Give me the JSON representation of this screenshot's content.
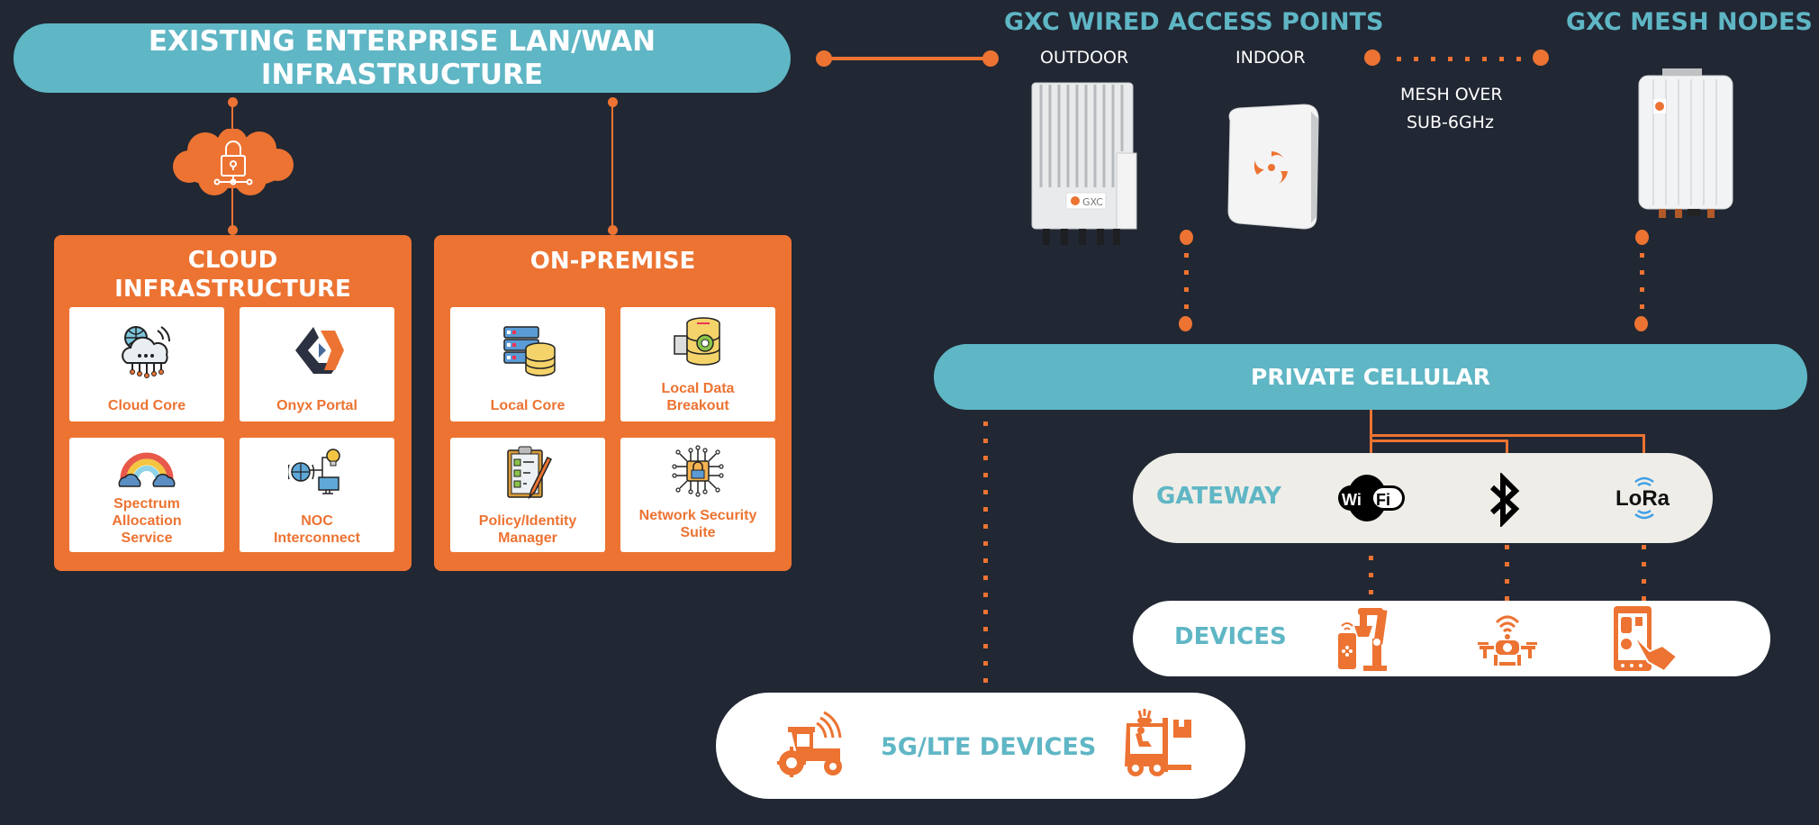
{
  "colors": {
    "background": "#212733",
    "teal": "#5fb6c5",
    "orange": "#ec7332",
    "white": "#ffffff",
    "gateway_fill": "#efede8"
  },
  "top_bar": {
    "line1": "EXISTING ENTERPRISE LAN/WAN",
    "line2": "INFRASTRUCTURE"
  },
  "cloud_security_icon": "cloud-lock-network-icon",
  "cloud_panel": {
    "title_line1": "CLOUD",
    "title_line2": "INFRASTRUCTURE",
    "tiles": [
      {
        "label": "Cloud Core",
        "icon": "cloud-network-icon"
      },
      {
        "label": "Onyx Portal",
        "icon": "onyx-logo-icon"
      },
      {
        "label": "Spectrum Allocation Service",
        "icon": "rainbow-icon"
      },
      {
        "label": "NOC Interconnect",
        "icon": "globe-monitor-icon"
      }
    ]
  },
  "onprem_panel": {
    "title": "ON-PREMISE",
    "tiles": [
      {
        "label": "Local Core",
        "icon": "server-database-icon"
      },
      {
        "label": "Local Data Breakout",
        "icon": "database-gear-icon"
      },
      {
        "label": "Policy/Identity Manager",
        "icon": "clipboard-checklist-icon"
      },
      {
        "label": "Network Security Suite",
        "icon": "chip-lock-icon"
      }
    ]
  },
  "wired_access_points": {
    "heading": "GXC WIRED ACCESS POINTS",
    "outdoor_label": "OUTDOOR",
    "indoor_label": "INDOOR",
    "outdoor_brand": "GXC"
  },
  "mesh": {
    "heading": "GXC MESH NODES",
    "link_line1": "MESH OVER",
    "link_line2": "SUB-6GHz"
  },
  "private_cellular": {
    "label": "PRIVATE CELLULAR"
  },
  "gateway": {
    "label": "GATEWAY",
    "icons": [
      {
        "name": "wifi-icon",
        "text": "WiFi"
      },
      {
        "name": "bluetooth-icon",
        "text": ""
      },
      {
        "name": "lora-icon",
        "text": "LoRa"
      }
    ]
  },
  "devices": {
    "label": "DEVICES",
    "icons": [
      "robot-arm-phone-icon",
      "drone-icon",
      "tablet-touch-icon"
    ]
  },
  "lte_devices": {
    "label": "5G/LTE DEVICES",
    "icons": [
      "tractor-icon",
      "forklift-icon"
    ]
  }
}
